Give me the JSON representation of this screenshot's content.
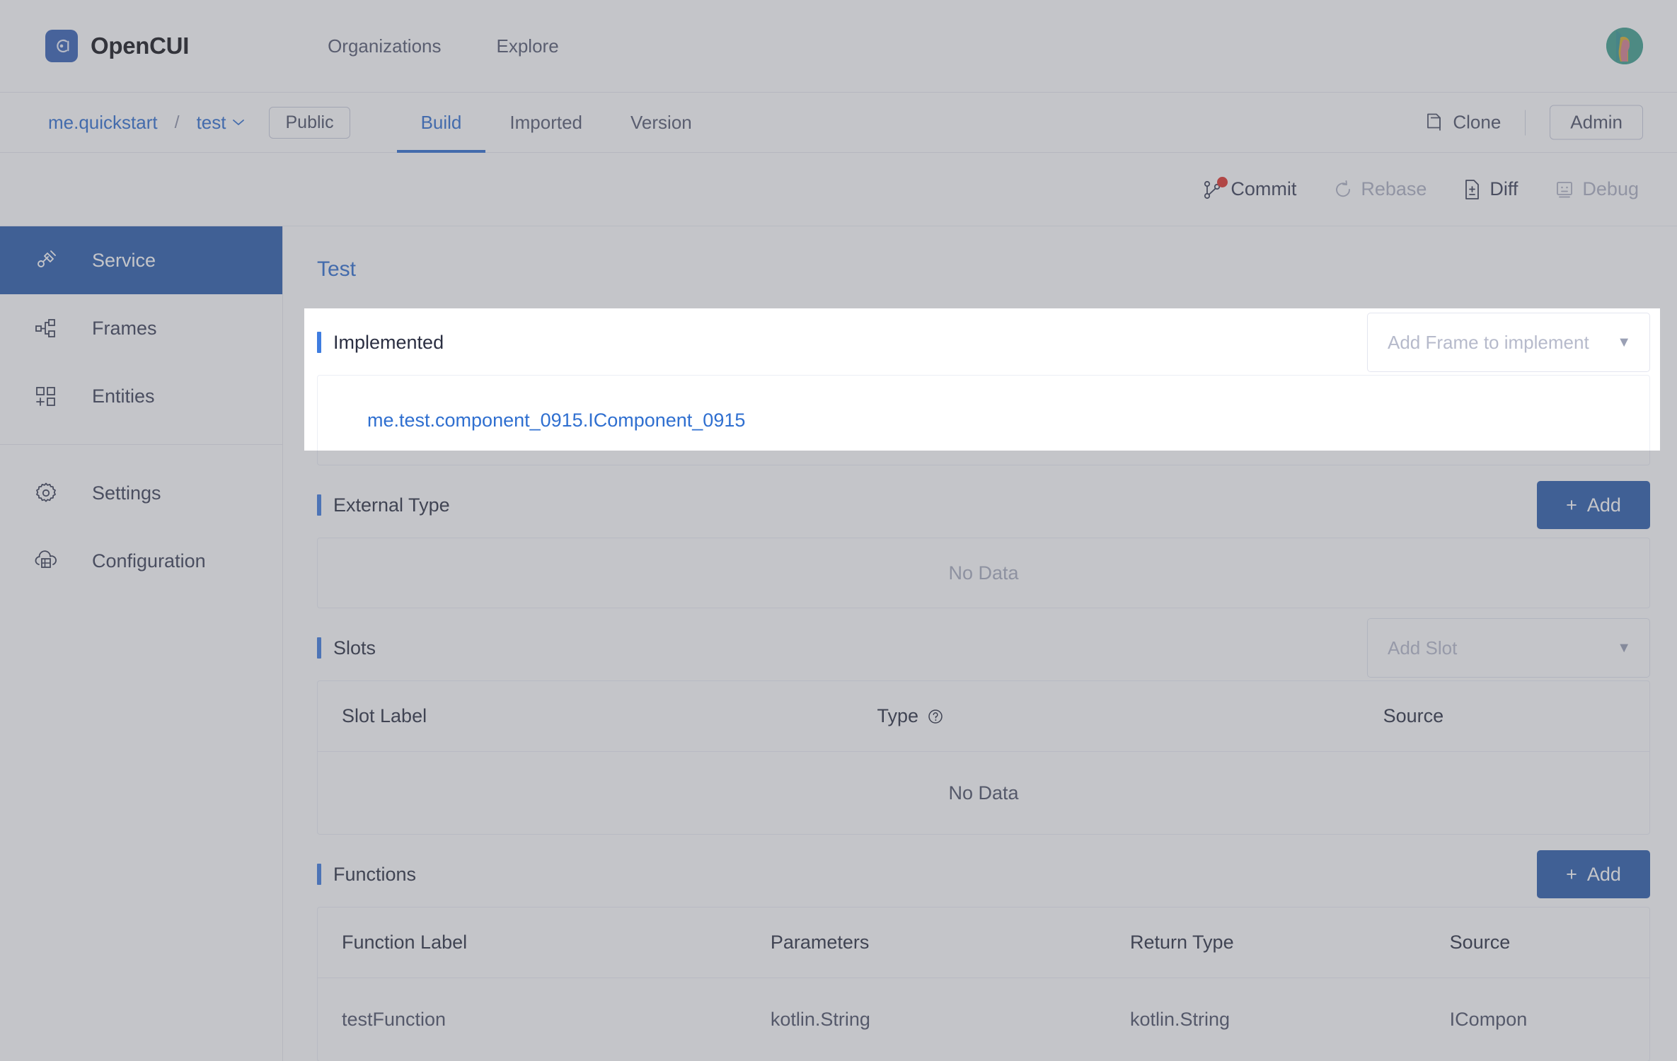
{
  "topnav": {
    "brand": "OpenCUI",
    "logo_icon": "opencui-logo-icon",
    "links": [
      {
        "label": "Organizations"
      },
      {
        "label": "Explore"
      }
    ],
    "avatar_icon": "user-avatar"
  },
  "repobar": {
    "breadcrumb": {
      "owner": "me.quickstart",
      "separator": "/",
      "project": "test",
      "project_caret": "⌄"
    },
    "visibility_badge": "Public",
    "tabs": [
      {
        "label": "Build",
        "active": true
      },
      {
        "label": "Imported",
        "active": false
      },
      {
        "label": "Version",
        "active": false
      }
    ],
    "clone_label": "Clone",
    "clone_icon": "copy-icon",
    "admin_label": "Admin"
  },
  "actionbar": {
    "actions": [
      {
        "label": "Commit",
        "icon": "git-branch-icon",
        "disabled": false,
        "badge": true
      },
      {
        "label": "Rebase",
        "icon": "refresh-icon",
        "disabled": true,
        "badge": false
      },
      {
        "label": "Diff",
        "icon": "file-diff-icon",
        "disabled": false,
        "badge": false
      },
      {
        "label": "Debug",
        "icon": "debug-monitor-icon",
        "disabled": true,
        "badge": false
      }
    ]
  },
  "sidebar": {
    "items": [
      {
        "label": "Service",
        "icon": "plug-connector-icon",
        "active": true
      },
      {
        "label": "Frames",
        "icon": "node-hierarchy-icon",
        "active": false
      },
      {
        "label": "Entities",
        "icon": "grid-plus-icon",
        "active": false
      },
      {
        "label": "Settings",
        "icon": "gear-icon",
        "active": false
      },
      {
        "label": "Configuration",
        "icon": "cloud-server-icon",
        "active": false
      }
    ]
  },
  "main": {
    "page_title": "Test",
    "implemented": {
      "title": "Implemented",
      "add_frame_placeholder": "Add Frame to implement",
      "items": [
        {
          "label": "me.test.component_0915.IComponent_0915"
        }
      ]
    },
    "external_type": {
      "title": "External Type",
      "add_label": "Add",
      "add_icon": "plus-icon",
      "empty_text": "No Data"
    },
    "slots": {
      "title": "Slots",
      "add_slot_placeholder": "Add Slot",
      "columns": [
        "Slot Label",
        "Type",
        "Source"
      ],
      "type_help_icon": "question-circle-icon",
      "rows": [],
      "empty_text": "No Data"
    },
    "functions": {
      "title": "Functions",
      "add_label": "Add",
      "add_icon": "plus-icon",
      "columns": [
        "Function Label",
        "Parameters",
        "Return Type",
        "Source"
      ],
      "rows": [
        {
          "function_label": "testFunction",
          "parameters": "kotlin.String",
          "return_type": "kotlin.String",
          "source": "ICompon"
        }
      ]
    }
  },
  "colors": {
    "accent_blue": "#2a5cab",
    "link_blue": "#2f6fd0",
    "title_bar": "#3f7de0",
    "commit_badge": "#e0342c",
    "scrim": "rgba(100,102,112,0.38)"
  }
}
